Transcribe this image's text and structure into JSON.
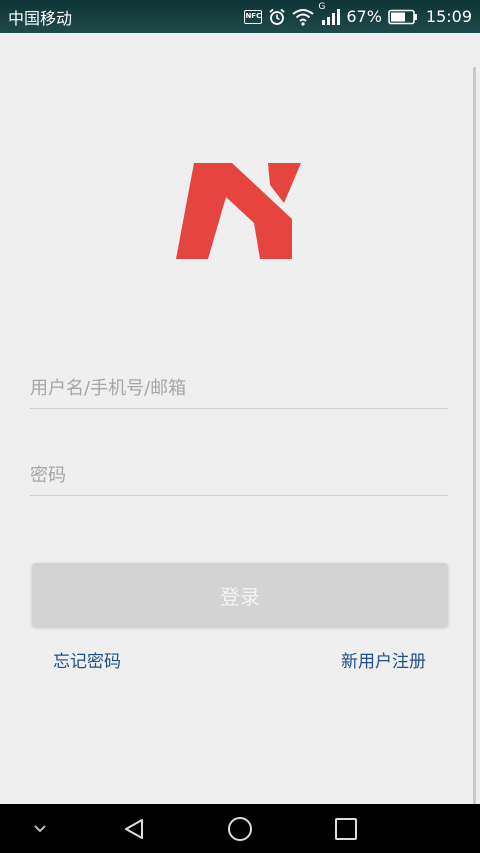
{
  "status_bar": {
    "carrier": "中国移动",
    "nfc_label": "NFC",
    "network_type": "G",
    "battery_percent": "67%",
    "time": "15:09"
  },
  "login": {
    "username_placeholder": "用户名/手机号/邮箱",
    "password_placeholder": "密码",
    "login_label": "登录",
    "forgot_password": "忘记密码",
    "register": "新用户注册"
  },
  "colors": {
    "logo_red": "#e5443f",
    "link_blue": "#1e4f86",
    "button_gray": "#d3d3d3"
  },
  "icons": {
    "nav": [
      "chevron-down-icon",
      "back-triangle-icon",
      "home-circle-icon",
      "recents-square-icon"
    ]
  }
}
